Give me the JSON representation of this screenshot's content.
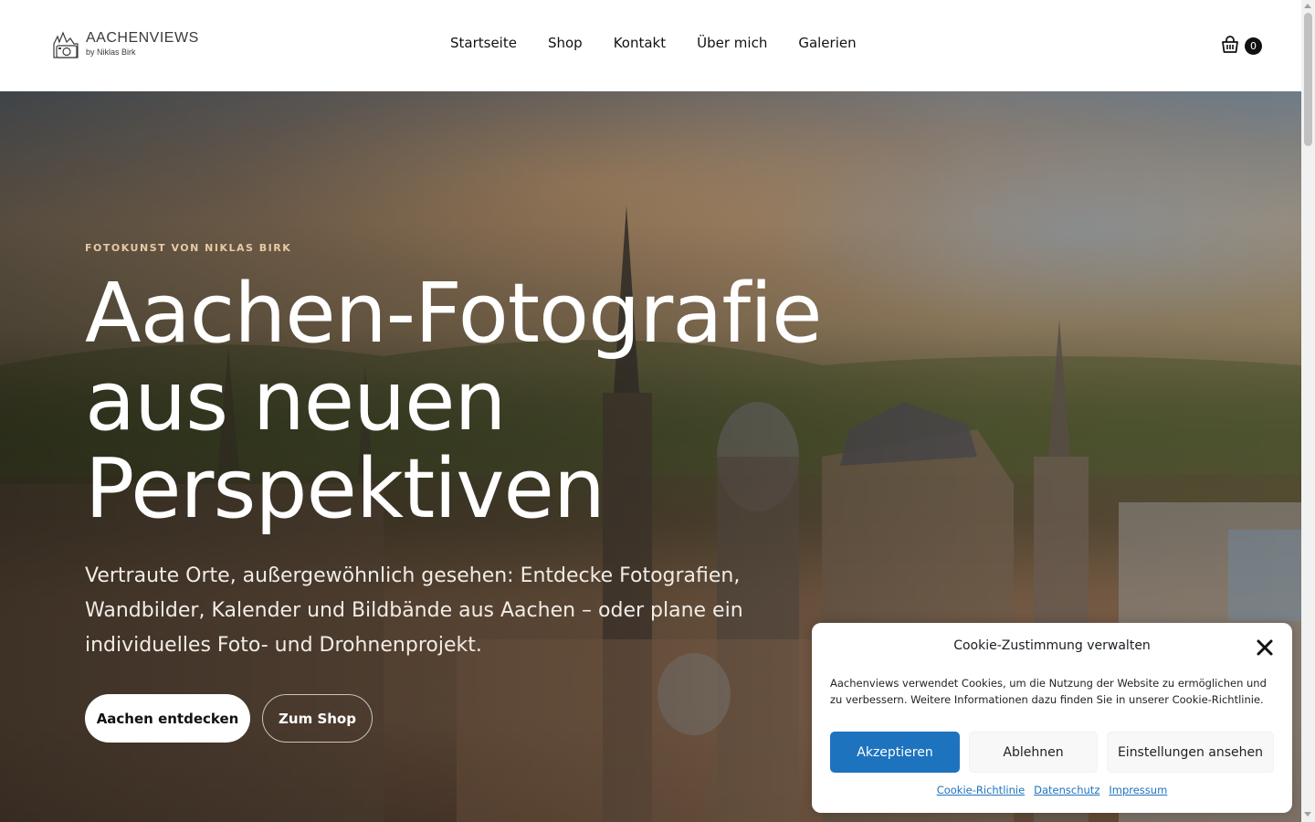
{
  "header": {
    "logo_title": "AACHENVIEWS",
    "logo_sub": "by Niklas Birk",
    "nav": [
      {
        "label": "Startseite"
      },
      {
        "label": "Shop"
      },
      {
        "label": "Kontakt"
      },
      {
        "label": "Über mich"
      },
      {
        "label": "Galerien"
      }
    ],
    "cart_icon": "shopping-basket-icon",
    "cart_count": "0"
  },
  "hero": {
    "eyebrow": "FOTOKUNST VON NIKLAS BIRK",
    "title_lines": [
      "Aachen-Fotografie",
      "aus neuen",
      "Perspektiven"
    ],
    "description": "Vertraute Orte, außergewöhnlich gesehen: Entdecke Fotografien, Wandbilder, Kalender und Bildbände aus Aachen – oder plane ein individuelles Foto- und Drohnenprojekt.",
    "primary_button": "Aachen entdecken",
    "secondary_button": "Zum Shop"
  },
  "cookie": {
    "title": "Cookie-Zustimmung verwalten",
    "text": "Aachenviews verwendet Cookies, um die Nutzung der Website zu ermöglichen und zu verbessern. Weitere Informationen dazu finden Sie in unserer Cookie-Richtlinie.",
    "accept": "Akzeptieren",
    "deny": "Ablehnen",
    "settings": "Einstellungen ansehen",
    "links": [
      {
        "label": "Cookie-Richtlinie"
      },
      {
        "label": "Datenschutz"
      },
      {
        "label": "Impressum"
      }
    ],
    "accent_color": "#1e73be"
  }
}
